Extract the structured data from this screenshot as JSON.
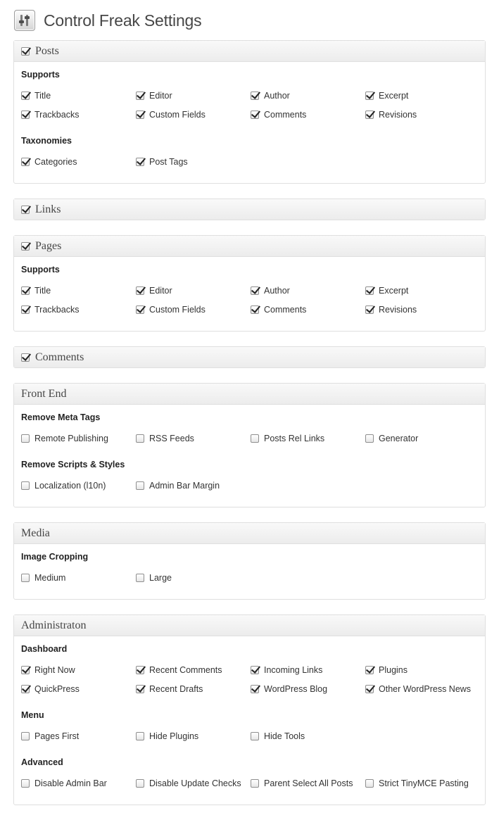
{
  "header": {
    "title": "Control Freak Settings",
    "icon": "sliders-icon"
  },
  "panels": [
    {
      "id": "posts",
      "title": "Posts",
      "has_toggle": true,
      "toggle_checked": true,
      "groups": [
        {
          "title": "Supports",
          "options": [
            {
              "label": "Title",
              "checked": true
            },
            {
              "label": "Editor",
              "checked": true
            },
            {
              "label": "Author",
              "checked": true
            },
            {
              "label": "Excerpt",
              "checked": true
            },
            {
              "label": "Trackbacks",
              "checked": true
            },
            {
              "label": "Custom Fields",
              "checked": true
            },
            {
              "label": "Comments",
              "checked": true
            },
            {
              "label": "Revisions",
              "checked": true
            }
          ]
        },
        {
          "title": "Taxonomies",
          "options": [
            {
              "label": "Categories",
              "checked": true
            },
            {
              "label": "Post Tags",
              "checked": true
            }
          ]
        }
      ]
    },
    {
      "id": "links",
      "title": "Links",
      "has_toggle": true,
      "toggle_checked": true,
      "groups": []
    },
    {
      "id": "pages",
      "title": "Pages",
      "has_toggle": true,
      "toggle_checked": true,
      "groups": [
        {
          "title": "Supports",
          "options": [
            {
              "label": "Title",
              "checked": true
            },
            {
              "label": "Editor",
              "checked": true
            },
            {
              "label": "Author",
              "checked": true
            },
            {
              "label": "Excerpt",
              "checked": true
            },
            {
              "label": "Trackbacks",
              "checked": true
            },
            {
              "label": "Custom Fields",
              "checked": true
            },
            {
              "label": "Comments",
              "checked": true
            },
            {
              "label": "Revisions",
              "checked": true
            }
          ]
        }
      ]
    },
    {
      "id": "comments",
      "title": "Comments",
      "has_toggle": true,
      "toggle_checked": true,
      "groups": []
    },
    {
      "id": "front-end",
      "title": "Front End",
      "has_toggle": false,
      "groups": [
        {
          "title": "Remove Meta Tags",
          "options": [
            {
              "label": "Remote Publishing",
              "checked": false
            },
            {
              "label": "RSS Feeds",
              "checked": false
            },
            {
              "label": "Posts Rel Links",
              "checked": false
            },
            {
              "label": "Generator",
              "checked": false
            }
          ]
        },
        {
          "title": "Remove Scripts & Styles",
          "options": [
            {
              "label": "Localization (l10n)",
              "checked": false
            },
            {
              "label": "Admin Bar Margin",
              "checked": false
            }
          ]
        }
      ]
    },
    {
      "id": "media",
      "title": "Media",
      "has_toggle": false,
      "groups": [
        {
          "title": "Image Cropping",
          "options": [
            {
              "label": "Medium",
              "checked": false
            },
            {
              "label": "Large",
              "checked": false
            }
          ]
        }
      ]
    },
    {
      "id": "administration",
      "title": "Administraton",
      "has_toggle": false,
      "groups": [
        {
          "title": "Dashboard",
          "options": [
            {
              "label": "Right Now",
              "checked": true
            },
            {
              "label": "Recent Comments",
              "checked": true
            },
            {
              "label": "Incoming Links",
              "checked": true
            },
            {
              "label": "Plugins",
              "checked": true
            },
            {
              "label": "QuickPress",
              "checked": true
            },
            {
              "label": "Recent Drafts",
              "checked": true
            },
            {
              "label": "WordPress Blog",
              "checked": true
            },
            {
              "label": "Other WordPress News",
              "checked": true
            }
          ]
        },
        {
          "title": "Menu",
          "options": [
            {
              "label": "Pages First",
              "checked": false
            },
            {
              "label": "Hide Plugins",
              "checked": false
            },
            {
              "label": "Hide Tools",
              "checked": false
            }
          ]
        },
        {
          "title": "Advanced",
          "options": [
            {
              "label": "Disable Admin Bar",
              "checked": false
            },
            {
              "label": "Disable Update Checks",
              "checked": false
            },
            {
              "label": "Parent Select All Posts",
              "checked": false
            },
            {
              "label": "Strict TinyMCE Pasting",
              "checked": false
            }
          ]
        }
      ]
    }
  ]
}
